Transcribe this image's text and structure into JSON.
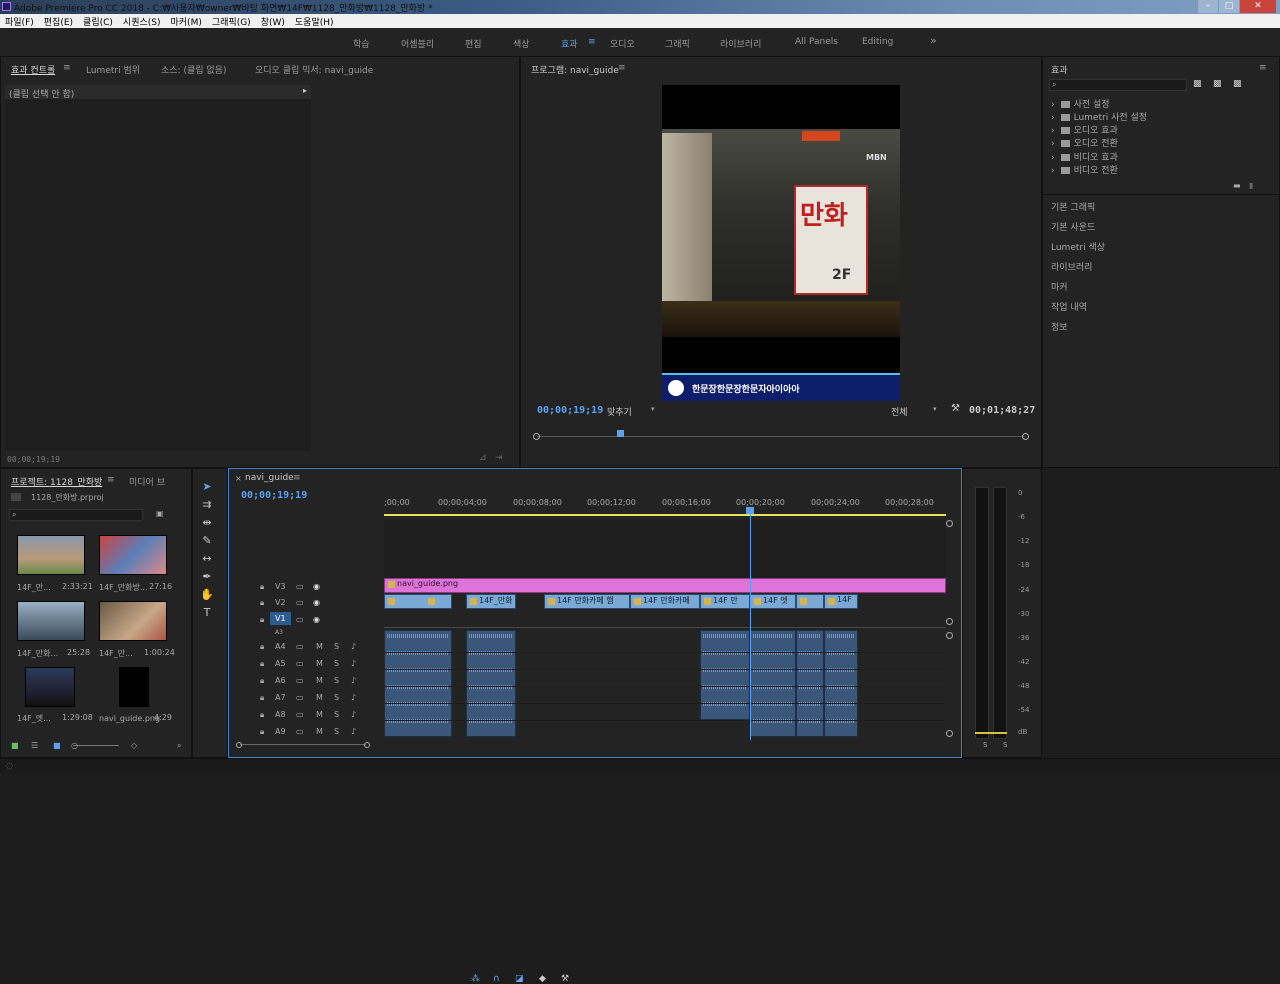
{
  "window": {
    "title": "Adobe Premiere Pro CC 2018 - C:₩사용자₩owner₩바탕 화면₩14F₩1128_만화방₩1128_만화방 *"
  },
  "menu": [
    "파일(F)",
    "편집(E)",
    "클립(C)",
    "시퀀스(S)",
    "마커(M)",
    "그래픽(G)",
    "창(W)",
    "도움말(H)"
  ],
  "workspaces": {
    "items": [
      "학습",
      "어셈블리",
      "편집",
      "색상",
      "효과",
      "오디오",
      "그래픽",
      "라이브러리",
      "All Panels",
      "Editing"
    ],
    "active": "효과",
    "more": "»"
  },
  "effect_controls": {
    "tabs": [
      "효과 컨트롤",
      "Lumetri 범위",
      "소스: (클립 없음)",
      "오디오 클립 믹서: navi_guide"
    ],
    "no_clip": "(클립 선택 안 함)",
    "timecode": "00;00;19;19"
  },
  "program": {
    "tab": "프로그램: navi_guide",
    "timecode": "00;00;19;19",
    "fit": "맞추기",
    "quality": "전체",
    "duration": "00;01;48;27",
    "video": {
      "sign1": "만화",
      "sign2": "2F",
      "watermark": "MBN",
      "subtitle": "한문장한문장한문자아이아아"
    }
  },
  "effects": {
    "title": "효과",
    "folders": [
      "사전 설정",
      "Lumetri 사전 설정",
      "오디오 효과",
      "오디오 전환",
      "비디오 효과",
      "비디오 전환"
    ],
    "sections": [
      "기본 그래픽",
      "기본 사운드",
      "Lumetri 색상",
      "라이브러리",
      "마커",
      "작업 내역",
      "정보"
    ]
  },
  "project": {
    "tab": "프로젝트: 1128_만화방",
    "tab2": "미디어 브",
    "file": "1128_만화방.prproj",
    "items": [
      {
        "name": "14F_만...",
        "dur": "2:33:21"
      },
      {
        "name": "14F_만화방...",
        "dur": "27:16"
      },
      {
        "name": "14F_만화...",
        "dur": "25:28"
      },
      {
        "name": "14F_만...",
        "dur": "1:00:24"
      },
      {
        "name": "14F_엣...",
        "dur": "1:29:08"
      },
      {
        "name": "navi_guide.png",
        "dur": "4:29"
      }
    ]
  },
  "timeline": {
    "tab": "navi_guide",
    "timecode": "00;00;19;19",
    "ruler": [
      ";00;00",
      "00;00;04;00",
      "00;00;08;00",
      "00;00;12;00",
      "00;00;16;00",
      "00;00;20;00",
      "00;00;24;00",
      "00;00;28;00"
    ],
    "video_tracks": [
      "V3",
      "V2",
      "V1"
    ],
    "audio_tracks": [
      "A3",
      "A4",
      "A5",
      "A6",
      "A7",
      "A8",
      "A9"
    ],
    "m": "M",
    "s": "S",
    "v3_clip": "navi_guide.png",
    "v2_clips": [
      "14F_만화",
      "14F 만화카페 햄",
      "14F 만화카페",
      "14F 만",
      "14F 엣",
      "14F"
    ]
  },
  "meter": {
    "ticks": [
      "0",
      "-6",
      "-12",
      "-18",
      "-24",
      "-30",
      "-36",
      "-42",
      "-48",
      "-54",
      "dB"
    ],
    "solo": [
      "S",
      "S"
    ]
  }
}
